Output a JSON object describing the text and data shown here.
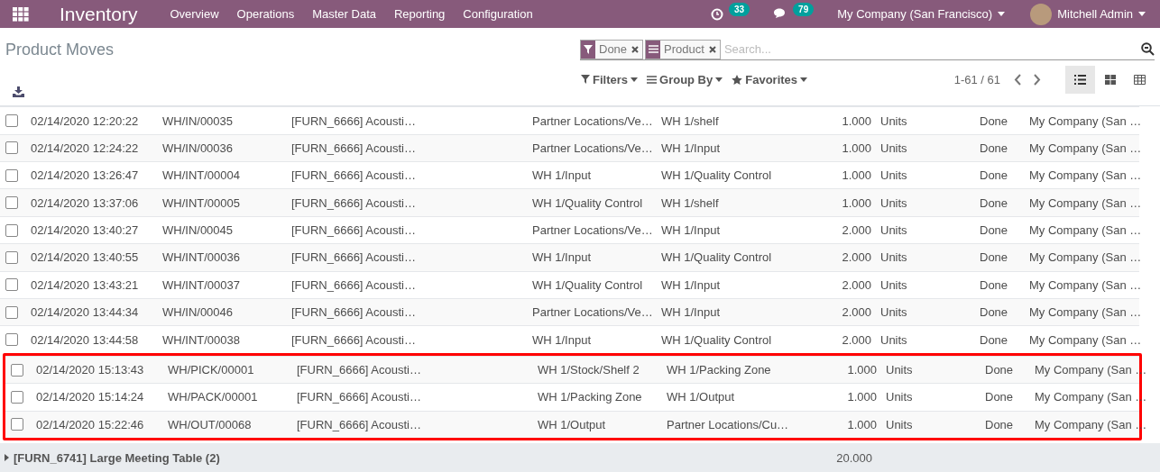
{
  "navbar": {
    "app_title": "Inventory",
    "menu": [
      "Overview",
      "Operations",
      "Master Data",
      "Reporting",
      "Configuration"
    ],
    "activity_count": "33",
    "message_count": "79",
    "company": "My Company (San Francisco)",
    "user": "Mitchell Admin"
  },
  "breadcrumb": "Product Moves",
  "search": {
    "facets": [
      {
        "kind": "filter",
        "label": "Done"
      },
      {
        "kind": "groupby",
        "label": "Product"
      }
    ],
    "placeholder": "Search..."
  },
  "toolbar": {
    "menus": [
      {
        "kind": "filter",
        "label": "Filters"
      },
      {
        "kind": "groupby",
        "label": "Group By"
      },
      {
        "kind": "favorite",
        "label": "Favorites"
      }
    ],
    "pager": "1-61 / 61",
    "views": [
      {
        "kind": "list",
        "selected": true
      },
      {
        "kind": "kanban",
        "selected": false
      },
      {
        "kind": "pivot",
        "selected": false
      }
    ]
  },
  "rows": [
    {
      "date": "02/14/2020 12:20:22",
      "reference": "WH/IN/00035",
      "product": "[FURN_6666] Acousti…",
      "from": "Partner Locations/Ve…",
      "to": "WH 1/shelf",
      "quantity": "1.000",
      "unit": "Units",
      "status": "Done",
      "company": "My Company (San …",
      "checked": false,
      "highlighted": false
    },
    {
      "date": "02/14/2020 12:24:22",
      "reference": "WH/IN/00036",
      "product": "[FURN_6666] Acousti…",
      "from": "Partner Locations/Ve…",
      "to": "WH 1/Input",
      "quantity": "1.000",
      "unit": "Units",
      "status": "Done",
      "company": "My Company (San …",
      "checked": false,
      "highlighted": false
    },
    {
      "date": "02/14/2020 13:26:47",
      "reference": "WH/INT/00004",
      "product": "[FURN_6666] Acousti…",
      "from": "WH 1/Input",
      "to": "WH 1/Quality Control",
      "quantity": "1.000",
      "unit": "Units",
      "status": "Done",
      "company": "My Company (San …",
      "checked": false,
      "highlighted": false
    },
    {
      "date": "02/14/2020 13:37:06",
      "reference": "WH/INT/00005",
      "product": "[FURN_6666] Acousti…",
      "from": "WH 1/Quality Control",
      "to": "WH 1/shelf",
      "quantity": "1.000",
      "unit": "Units",
      "status": "Done",
      "company": "My Company (San …",
      "checked": false,
      "highlighted": false
    },
    {
      "date": "02/14/2020 13:40:27",
      "reference": "WH/IN/00045",
      "product": "[FURN_6666] Acousti…",
      "from": "Partner Locations/Ve…",
      "to": "WH 1/Input",
      "quantity": "2.000",
      "unit": "Units",
      "status": "Done",
      "company": "My Company (San …",
      "checked": false,
      "highlighted": false
    },
    {
      "date": "02/14/2020 13:40:55",
      "reference": "WH/INT/00036",
      "product": "[FURN_6666] Acousti…",
      "from": "WH 1/Input",
      "to": "WH 1/Quality Control",
      "quantity": "2.000",
      "unit": "Units",
      "status": "Done",
      "company": "My Company (San …",
      "checked": false,
      "highlighted": false
    },
    {
      "date": "02/14/2020 13:43:21",
      "reference": "WH/INT/00037",
      "product": "[FURN_6666] Acousti…",
      "from": "WH 1/Quality Control",
      "to": "WH 1/Input",
      "quantity": "2.000",
      "unit": "Units",
      "status": "Done",
      "company": "My Company (San …",
      "checked": false,
      "highlighted": false
    },
    {
      "date": "02/14/2020 13:44:34",
      "reference": "WH/IN/00046",
      "product": "[FURN_6666] Acousti…",
      "from": "Partner Locations/Ve…",
      "to": "WH 1/Input",
      "quantity": "2.000",
      "unit": "Units",
      "status": "Done",
      "company": "My Company (San …",
      "checked": false,
      "highlighted": false
    },
    {
      "date": "02/14/2020 13:44:58",
      "reference": "WH/INT/00038",
      "product": "[FURN_6666] Acousti…",
      "from": "WH 1/Input",
      "to": "WH 1/Quality Control",
      "quantity": "2.000",
      "unit": "Units",
      "status": "Done",
      "company": "My Company (San …",
      "checked": false,
      "highlighted": false
    },
    {
      "date": "02/14/2020 15:13:43",
      "reference": "WH/PICK/00001",
      "product": "[FURN_6666] Acousti…",
      "from": "WH 1/Stock/Shelf 2",
      "to": "WH 1/Packing Zone",
      "quantity": "1.000",
      "unit": "Units",
      "status": "Done",
      "company": "My Company (San …",
      "checked": false,
      "highlighted": true
    },
    {
      "date": "02/14/2020 15:14:24",
      "reference": "WH/PACK/00001",
      "product": "[FURN_6666] Acousti…",
      "from": "WH 1/Packing Zone",
      "to": "WH 1/Output",
      "quantity": "1.000",
      "unit": "Units",
      "status": "Done",
      "company": "My Company (San …",
      "checked": false,
      "highlighted": true
    },
    {
      "date": "02/14/2020 15:22:46",
      "reference": "WH/OUT/00068",
      "product": "[FURN_6666] Acousti…",
      "from": "WH 1/Output",
      "to": "Partner Locations/Cu…",
      "quantity": "1.000",
      "unit": "Units",
      "status": "Done",
      "company": "My Company (San …",
      "checked": false,
      "highlighted": true
    }
  ],
  "group": {
    "label": "[FURN_6741] Large Meeting Table (2)",
    "total": "20.000",
    "expanded": false
  }
}
